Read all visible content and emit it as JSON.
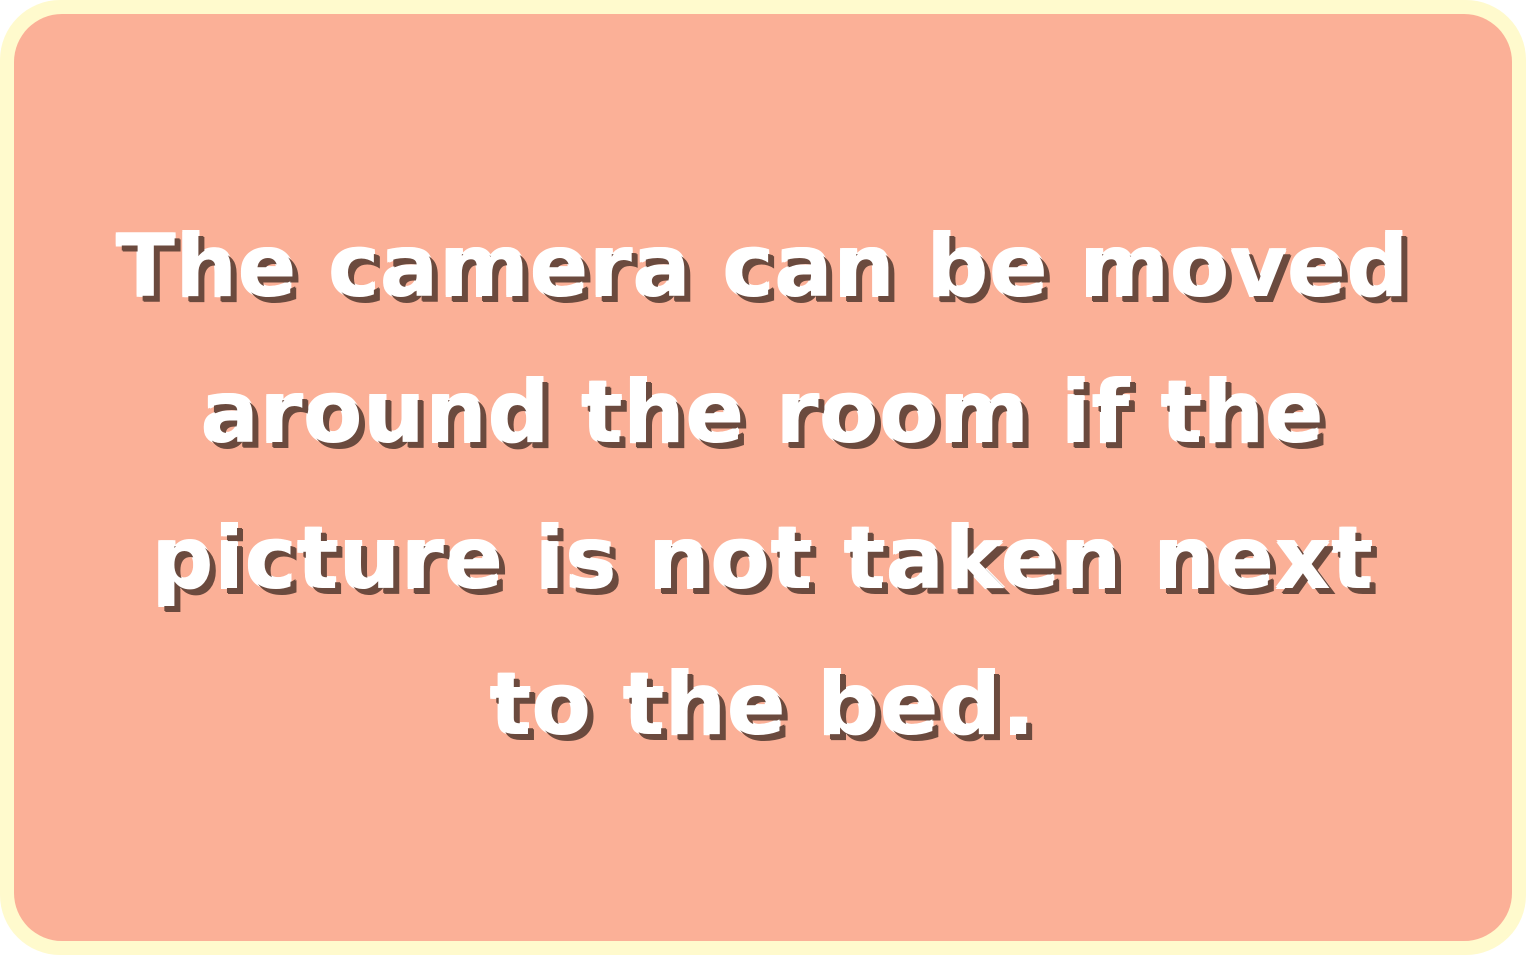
{
  "dialog": {
    "lines": [
      "The camera can be moved",
      "around the room if the",
      "picture is not taken next",
      "to the bed."
    ]
  },
  "colors": {
    "frame": "#fffacd",
    "panel": "#fbb097",
    "text": "#ffffff",
    "text_shadow": "#6b4a3e"
  }
}
